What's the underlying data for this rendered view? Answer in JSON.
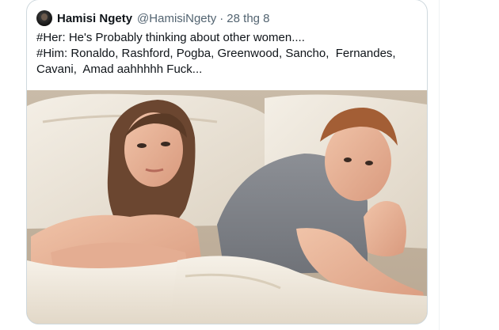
{
  "tweet": {
    "author_name": "Hamisi Ngety",
    "author_handle": "@HamisiNgety",
    "separator": "·",
    "timestamp": "28 thg 8",
    "text_lines": [
      "#Her: He's Probably thinking about other women....",
      "#Him: Ronaldo, Rashford, Pogba, Greenwood, Sancho,  Fernandes,",
      "Cavani,  Amad aahhhhh Fuck..."
    ]
  },
  "colors": {
    "border": "#cfd9de",
    "primary_text": "#0f1419",
    "secondary_text": "#536471"
  },
  "icons": {
    "avatar": "profile-avatar"
  }
}
